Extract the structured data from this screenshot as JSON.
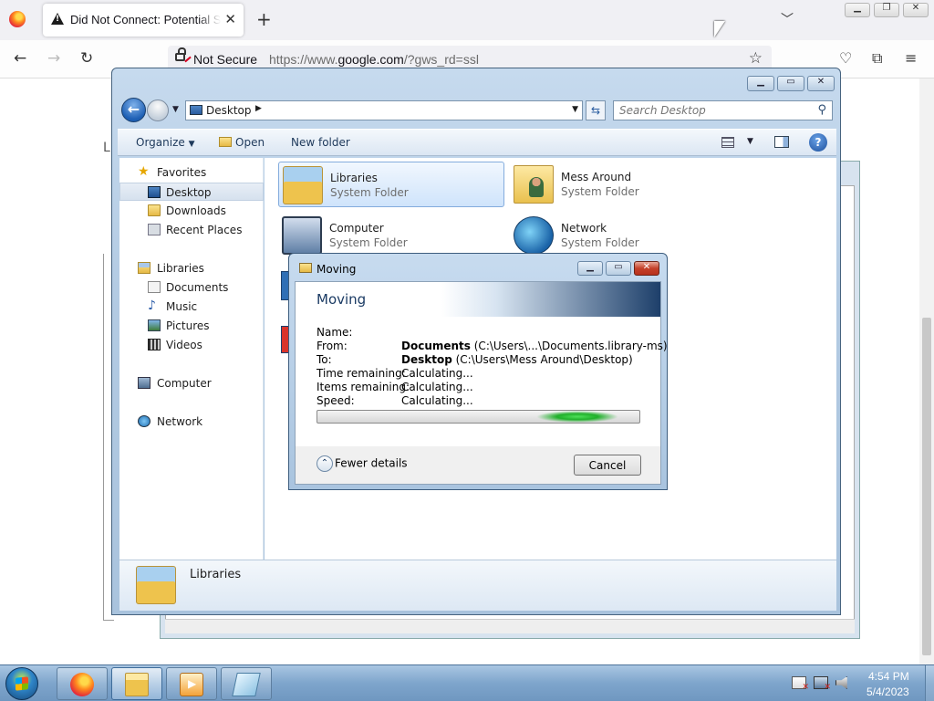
{
  "browser": {
    "tab_title": "Did Not Connect: Potential Security Issue",
    "new_tab_symbol": "+",
    "close_symbol": "✕",
    "security_label": "Not Secure",
    "url_prefix": "https://www.",
    "url_host": "google.com",
    "url_suffix": "/?gws_rd=ssl",
    "page_fragment": "L"
  },
  "explorer": {
    "address": "Desktop",
    "search_placeholder": "Search Desktop",
    "commands": {
      "organize": "Organize",
      "open": "Open",
      "new_folder": "New folder"
    },
    "help_symbol": "?",
    "nav": {
      "favorites": "Favorites",
      "desktop": "Desktop",
      "downloads": "Downloads",
      "recent_places": "Recent Places",
      "libraries": "Libraries",
      "documents": "Documents",
      "music": "Music",
      "pictures": "Pictures",
      "videos": "Videos",
      "computer": "Computer",
      "network": "Network"
    },
    "items": [
      {
        "name": "Libraries",
        "type": "System Folder",
        "icon": "libraries-folder-icon",
        "selected": true
      },
      {
        "name": "Mess Around",
        "type": "System Folder",
        "icon": "user-folder-icon"
      },
      {
        "name": "Computer",
        "type": "System Folder",
        "icon": "computer-icon"
      },
      {
        "name": "Network",
        "type": "System Folder",
        "icon": "network-globe-icon"
      }
    ],
    "details_name": "Libraries"
  },
  "moving": {
    "title": "Moving",
    "heading": "Moving",
    "labels": {
      "name": "Name:",
      "from": "From:",
      "to": "To:",
      "time": "Time remaining:",
      "items": "Items remaining:",
      "speed": "Speed:"
    },
    "from_bold": "Documents",
    "from_path": " (C:\\Users\\...\\Documents.library-ms)",
    "to_bold": "Desktop",
    "to_path": " (C:\\Users\\Mess Around\\Desktop)",
    "time_value": "Calculating...",
    "items_value": "Calculating...",
    "speed_value": "Calculating...",
    "fewer_details": "Fewer details",
    "cancel": "Cancel"
  },
  "taskbar": {
    "time": "4:54 PM",
    "date": "5/4/2023"
  },
  "colors": {
    "aero_blue": "#a9c4df",
    "selection": "#cfe4fb",
    "progress_green": "#1fb02a",
    "close_red": "#c5412a"
  }
}
